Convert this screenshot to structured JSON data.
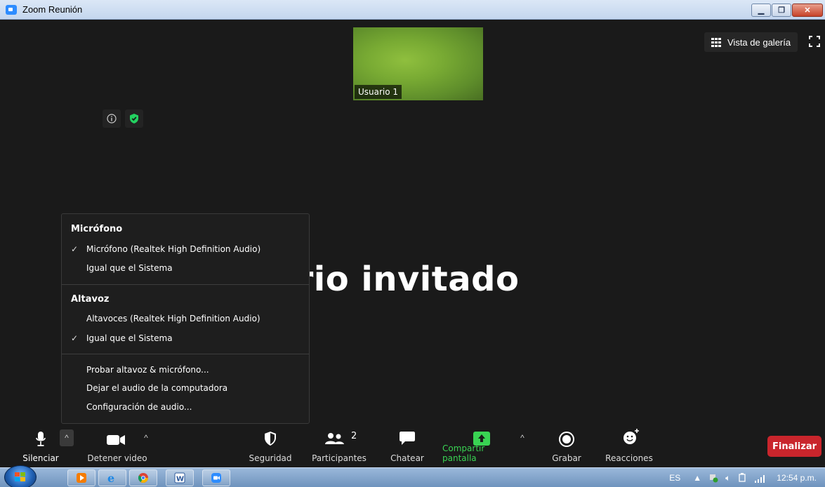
{
  "window": {
    "title": "Zoom Reunión"
  },
  "meeting": {
    "participant_thumb_name": "Usuario 1",
    "gallery_view_label": "Vista de galería",
    "guest_display_name": "uario invitado"
  },
  "audio_menu": {
    "microphone_section": "Micrófono",
    "microphone_items": [
      {
        "label": "Micrófono (Realtek High Definition Audio)",
        "checked": true
      },
      {
        "label": "Igual que el Sistema",
        "checked": false
      }
    ],
    "speaker_section": "Altavoz",
    "speaker_items": [
      {
        "label": "Altavoces (Realtek High Definition Audio)",
        "checked": false
      },
      {
        "label": "Igual que el Sistema",
        "checked": true
      }
    ],
    "actions": [
      "Probar altavoz & micrófono...",
      "Dejar el audio de la computadora",
      "Configuración de audio..."
    ],
    "check_glyph": "✓"
  },
  "toolbar": {
    "mute_label": "Silenciar",
    "video_label": "Detener video",
    "security_label": "Seguridad",
    "participants_label": "Participantes",
    "participants_count": "2",
    "chat_label": "Chatear",
    "share_label": "Compartir pantalla",
    "record_label": "Grabar",
    "reactions_label": "Reacciones",
    "end_label": "Finalizar",
    "share_color": "#39d353",
    "end_color": "#c9252c"
  },
  "taskbar": {
    "language": "ES",
    "time": "12:54 p.m."
  }
}
